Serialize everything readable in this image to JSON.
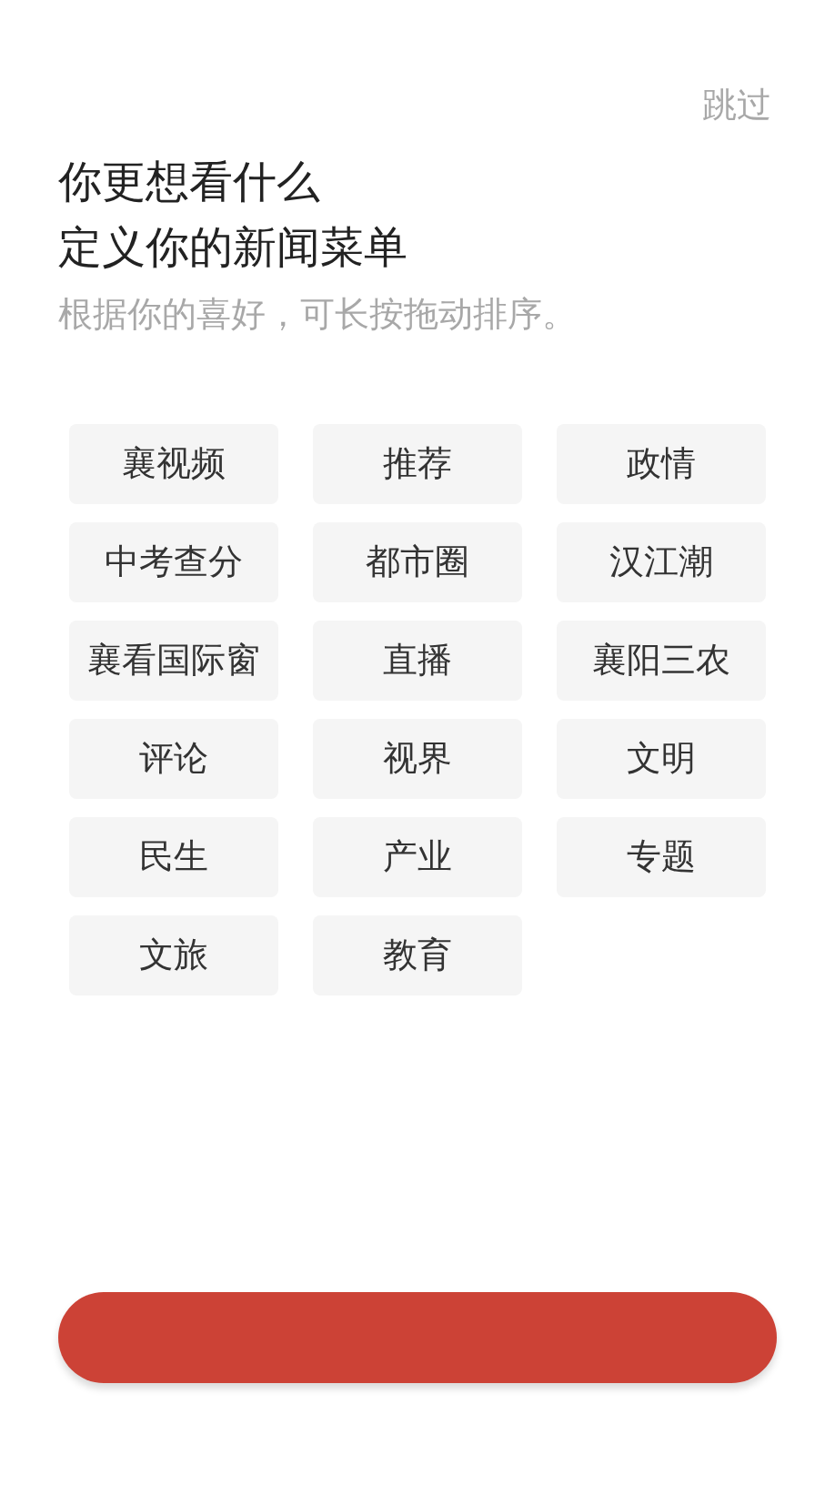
{
  "skip": "跳过",
  "title_lines": [
    "你更想看什么",
    "定义你的新闻菜单"
  ],
  "subtitle": "根据你的喜好，可长按拖动排序。",
  "channels": [
    {
      "label": "襄视频"
    },
    {
      "label": "推荐"
    },
    {
      "label": "政情"
    },
    {
      "label": "中考查分"
    },
    {
      "label": "都市圈"
    },
    {
      "label": "汉江潮"
    },
    {
      "label": "襄看国际窗"
    },
    {
      "label": "直播"
    },
    {
      "label": "襄阳三农"
    },
    {
      "label": "评论"
    },
    {
      "label": "视界"
    },
    {
      "label": "文明"
    },
    {
      "label": "民生"
    },
    {
      "label": "产业"
    },
    {
      "label": "专题"
    },
    {
      "label": "文旅"
    },
    {
      "label": "教育"
    }
  ],
  "confirm_button": {
    "kind": "button"
  }
}
